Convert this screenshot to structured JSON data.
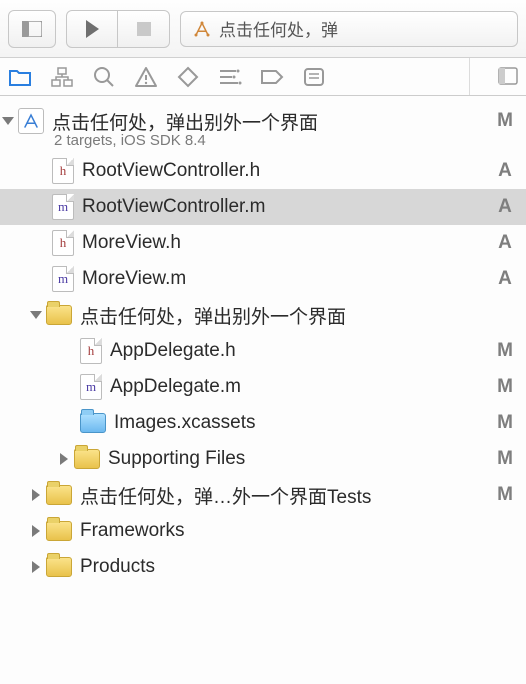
{
  "toolbar": {
    "scheme_text": "点击任何处，弹"
  },
  "project": {
    "name": "点击任何处，弹出别外一个界面",
    "subtitle": "2 targets, iOS SDK 8.4",
    "status": "M"
  },
  "tree": [
    {
      "indent": 1,
      "icon": "h",
      "name": "RootViewController.h",
      "status": "A",
      "selected": false
    },
    {
      "indent": 1,
      "icon": "m",
      "name": "RootViewController.m",
      "status": "A",
      "selected": true
    },
    {
      "indent": 1,
      "icon": "h",
      "name": "MoreView.h",
      "status": "A",
      "selected": false
    },
    {
      "indent": 1,
      "icon": "m",
      "name": "MoreView.m",
      "status": "A",
      "selected": false
    },
    {
      "indent": 1,
      "icon": "folder",
      "name": "点击任何处，弹出别外一个界面",
      "status": "",
      "disclosure": "open"
    },
    {
      "indent": 2,
      "icon": "h",
      "name": "AppDelegate.h",
      "status": "M"
    },
    {
      "indent": 2,
      "icon": "m",
      "name": "AppDelegate.m",
      "status": "M"
    },
    {
      "indent": 2,
      "icon": "bluefolder",
      "name": "Images.xcassets",
      "status": "M"
    },
    {
      "indent": 2,
      "icon": "folder",
      "name": "Supporting Files",
      "status": "M",
      "disclosure": "closed"
    },
    {
      "indent": 1,
      "icon": "folder",
      "name": "点击任何处，弹…外一个界面Tests",
      "status": "M",
      "disclosure": "closed"
    },
    {
      "indent": 1,
      "icon": "folder",
      "name": "Frameworks",
      "status": "",
      "disclosure": "closed"
    },
    {
      "indent": 1,
      "icon": "folder",
      "name": "Products",
      "status": "",
      "disclosure": "closed"
    }
  ],
  "icons": {
    "h_letter": "h",
    "m_letter": "m"
  }
}
